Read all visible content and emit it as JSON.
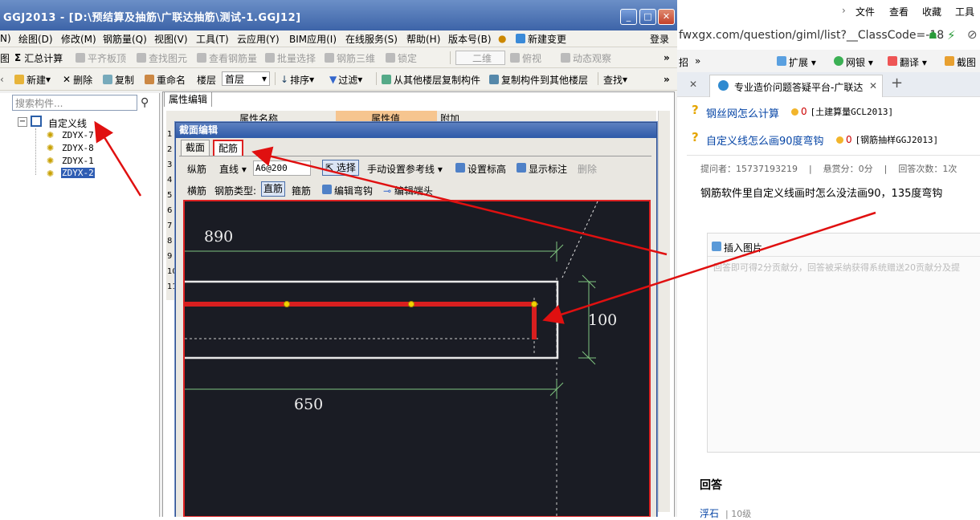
{
  "app": {
    "title": "GGJ2013 - [D:\\预结算及抽筋\\广联达抽筋\\测试-1.GGJ12]",
    "window_buttons": [
      "_",
      "□",
      "✕"
    ]
  },
  "menubar": {
    "items": [
      "N)",
      "绘图(D)",
      "修改(M)",
      "钢筋量(Q)",
      "视图(V)",
      "工具(T)",
      "云应用(Y)",
      "BIM应用(I)",
      "在线服务(S)",
      "帮助(H)",
      "版本号(B)",
      "新建变更"
    ],
    "login": "登录"
  },
  "toolbar1": {
    "items": [
      "图",
      "汇总计算",
      "平齐板顶",
      "查找图元",
      "查看钢筋量",
      "批量选择",
      "钢筋三维",
      "锁定",
      "二维",
      "俯视",
      "动态观察"
    ],
    "more": "»"
  },
  "toolbar2": {
    "items": [
      "新建",
      "删除",
      "复制",
      "重命名",
      "楼层",
      "首层",
      "排序",
      "过滤",
      "从其他楼层复制构件",
      "复制构件到其他楼层",
      "查找"
    ],
    "more": "»"
  },
  "tree": {
    "search_placeholder": "搜索构件...",
    "root": "自定义线",
    "children": [
      "ZDYX-7",
      "ZDYX-8",
      "ZDYX-1",
      "ZDYX-2"
    ],
    "selected_index": 3
  },
  "property_panel": {
    "tab": "属性编辑",
    "headers": [
      "属性名称",
      "属性值",
      "附加"
    ],
    "row_numbers": [
      "1",
      "2",
      "3",
      "4",
      "5",
      "6",
      "7",
      "8",
      "9",
      "10",
      "11"
    ]
  },
  "dialog": {
    "title": "截面编辑",
    "tabs": [
      "截面",
      "配筋"
    ],
    "active_tab": 1,
    "row1": {
      "label": "纵筋",
      "type_select": "直线",
      "spec_value": "A6@200",
      "select_button": "选择",
      "ref_line": "手动设置参考线",
      "set_elevation": "设置标高",
      "show_marks": "显示标注",
      "delete": "删除"
    },
    "row2": {
      "label": "横筋",
      "rebar_type_label": "钢筋类型:",
      "straight": "直筋",
      "stirrup": "箍筋",
      "edit_hook": "编辑弯钩",
      "edit_end": "编辑端头"
    },
    "canvas": {
      "dim_top": "890",
      "dim_right": "100",
      "dim_bottom": "650"
    }
  },
  "browser": {
    "menu": [
      "文件",
      "查看",
      "收藏",
      "工具"
    ],
    "url": "fwxgx.com/question/giml/list?__ClassCode=-18",
    "toolbar": [
      "招",
      "»",
      "扩展",
      "网银",
      "翻译",
      "截图"
    ],
    "tab_title": "专业造价问题答疑平台-广联达",
    "questions": [
      {
        "title": "钢丝网怎么计算",
        "reward": "0",
        "tag": "[土建算量GCL2013]"
      },
      {
        "title": "自定义线怎么画90度弯钩",
        "reward": "0",
        "tag": "[钢筋抽样GGJ2013]"
      }
    ],
    "meta": "提问者：15737193219    |    悬赏分：0分    |    回答次数：1次",
    "question_body": "钢筋软件里自定义线画时怎么没法画90，135度弯钩",
    "insert_image": "插入图片",
    "answer_placeholder": "回答即可得2分贡献分，回答被采纳获得系统赠送20贡献分及提",
    "answers_heading": "回答",
    "answerer": "浮石",
    "answerer_level": "10级"
  },
  "colors": {
    "title_blue": "#3d64a8",
    "canvas_bg": "#1a1c24",
    "rebar_red": "#d81f1f",
    "annotation_red": "#e01010",
    "dim_green": "#7fc47f",
    "link_blue": "#0645a6"
  }
}
